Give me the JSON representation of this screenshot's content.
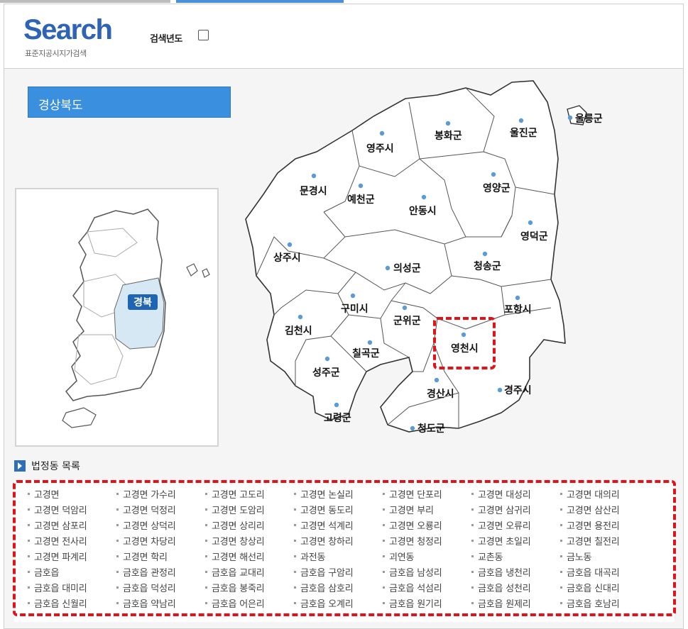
{
  "header": {
    "logo_title": "Search",
    "logo_subtitle": "표준지공시지가검색",
    "year_label": "검색년도"
  },
  "province": {
    "name": "경상북도"
  },
  "mini_map": {
    "highlight_label": "경북"
  },
  "regions": [
    {
      "name": "울릉군"
    },
    {
      "name": "영주시"
    },
    {
      "name": "봉화군"
    },
    {
      "name": "울진군"
    },
    {
      "name": "문경시"
    },
    {
      "name": "예천군"
    },
    {
      "name": "안동시"
    },
    {
      "name": "영양군"
    },
    {
      "name": "영덕군"
    },
    {
      "name": "상주시"
    },
    {
      "name": "의성군"
    },
    {
      "name": "청송군"
    },
    {
      "name": "구미시"
    },
    {
      "name": "군위군"
    },
    {
      "name": "포항시"
    },
    {
      "name": "김천시"
    },
    {
      "name": "영천시"
    },
    {
      "name": "칠곡군"
    },
    {
      "name": "성주군"
    },
    {
      "name": "경산시"
    },
    {
      "name": "경주시"
    },
    {
      "name": "고령군"
    },
    {
      "name": "청도군"
    }
  ],
  "list": {
    "title": "법정동 목록",
    "items": [
      "고경면",
      "고경면 가수리",
      "고경면 고도리",
      "고경면 논실리",
      "고경면 단포리",
      "고경면 대성리",
      "고경면 대의리",
      "고경면 덕암리",
      "고경면 덕정리",
      "고경면 도암리",
      "고경면 동도리",
      "고경면 부리",
      "고경면 삼귀리",
      "고경면 삼산리",
      "고경면 삼포리",
      "고경면 상덕리",
      "고경면 상리리",
      "고경면 석계리",
      "고경면 오룡리",
      "고경면 오류리",
      "고경면 용전리",
      "고경면 전사리",
      "고경면 차당리",
      "고경면 창상리",
      "고경면 창하리",
      "고경면 청정리",
      "고경면 초일리",
      "고경면 칠전리",
      "고경면 파계리",
      "고경면 학리",
      "고경면 해선리",
      "과전동",
      "괴연동",
      "교촌동",
      "금노동",
      "금호읍",
      "금호읍 관정리",
      "금호읍 교대리",
      "금호읍 구암리",
      "금호읍 남성리",
      "금호읍 냉천리",
      "금호읍 대곡리",
      "금호읍 대미리",
      "금호읍 덕성리",
      "금호읍 봉죽리",
      "금호읍 삼호리",
      "금호읍 석섬리",
      "금호읍 성천리",
      "금호읍 신대리",
      "금호읍 신월리",
      "금호읍 약남리",
      "금호읍 어은리",
      "금호읍 오계리",
      "금호읍 원기리",
      "금호읍 원제리",
      "금호읍 호남리"
    ]
  }
}
